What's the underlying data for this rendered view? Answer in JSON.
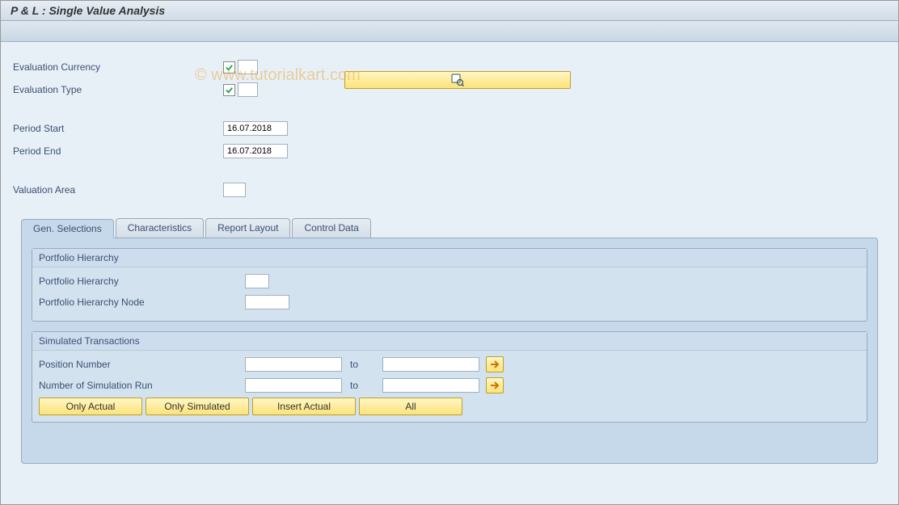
{
  "title": "P & L : Single Value Analysis",
  "watermark": "© www.tutorialkart.com",
  "form": {
    "eval_currency_label": "Evaluation Currency",
    "eval_type_label": "Evaluation Type",
    "period_start_label": "Period Start",
    "period_start_value": "16.07.2018",
    "period_end_label": "Period End",
    "period_end_value": "16.07.2018",
    "valuation_area_label": "Valuation Area"
  },
  "tabs": {
    "gen_selections": "Gen. Selections",
    "characteristics": "Characteristics",
    "report_layout": "Report Layout",
    "control_data": "Control Data"
  },
  "portfolio": {
    "group_title": "Portfolio Hierarchy",
    "hierarchy_label": "Portfolio Hierarchy",
    "node_label": "Portfolio Hierarchy Node"
  },
  "simulated": {
    "group_title": "Simulated Transactions",
    "position_label": "Position Number",
    "simrun_label": "Number of Simulation Run",
    "to_label": "to",
    "btn_actual": "Only Actual",
    "btn_simulated": "Only Simulated",
    "btn_insert": "Insert Actual",
    "btn_all": "All"
  }
}
